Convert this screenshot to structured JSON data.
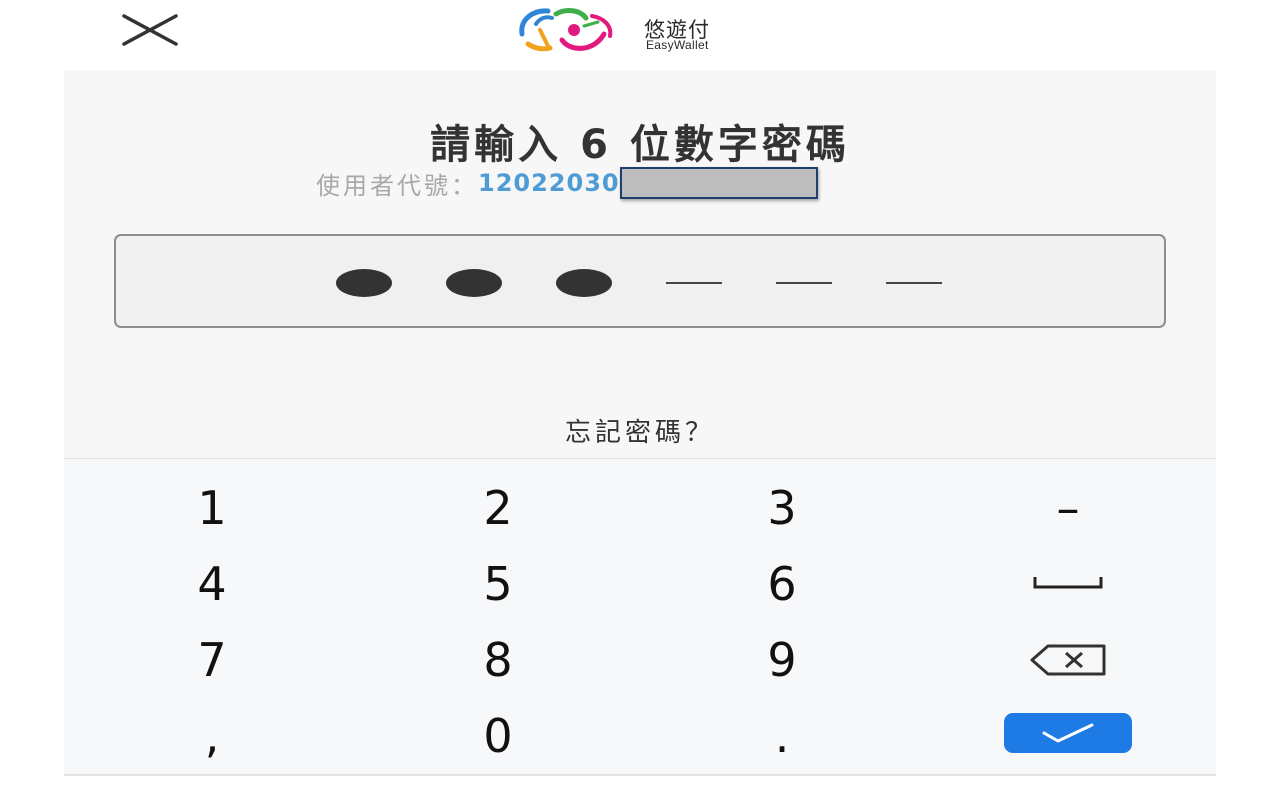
{
  "header": {
    "close_icon": "close-icon",
    "logo": {
      "name": "悠遊付",
      "subtitle": "EasyWallet"
    }
  },
  "pin_prompt": {
    "title": "請輸入 6 位數字密碼",
    "user_label": "使用者代號：",
    "user_id": "12022030",
    "pin_length": 6,
    "digits_entered": 3,
    "forgot_link": "忘記密碼？"
  },
  "keypad": {
    "keys": [
      {
        "label": "1"
      },
      {
        "label": "2"
      },
      {
        "label": "3"
      },
      {
        "label": "–"
      },
      {
        "label": "4"
      },
      {
        "label": "5"
      },
      {
        "label": "6"
      },
      {
        "label": "space",
        "icon": "space-icon"
      },
      {
        "label": "7"
      },
      {
        "label": "8"
      },
      {
        "label": "9"
      },
      {
        "label": "backspace",
        "icon": "backspace-icon"
      },
      {
        "label": ","
      },
      {
        "label": "0"
      },
      {
        "label": "."
      },
      {
        "label": "confirm",
        "icon": "check-icon"
      }
    ]
  },
  "colors": {
    "accent": "#1e7be6",
    "user_id": "#4e9bd6",
    "panel_bg": "#f7f7f7",
    "text": "#333333"
  }
}
